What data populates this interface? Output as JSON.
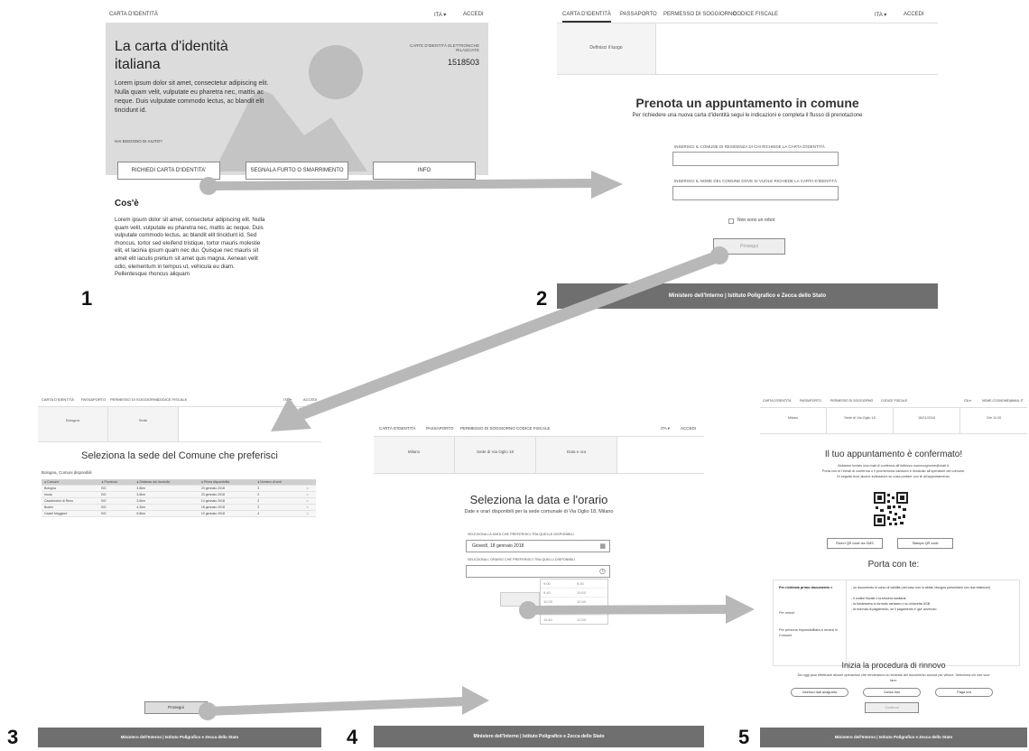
{
  "nav": {
    "carta": "CARTA D'IDENTITÀ",
    "passaporto": "PASSAPORTO",
    "permesso": "PERMESSO DI SOGGIORNO",
    "codice": "CODICE FISCALE",
    "lang": "ITA ▾",
    "accedi": "ACCEDI",
    "accedi_user": "NOME.COGNOME@MAIL.IT"
  },
  "footer_text": "Ministero dell'Interno | Istituto Poligrafico e Zecca dello Stato",
  "steps": {
    "s1": "1",
    "s2": "2",
    "s3": "3",
    "s4": "4",
    "s5": "5"
  },
  "screen1": {
    "title": "La carta d'identità italiana",
    "intro": "Lorem ipsum dolor sit amet, consectetur adipiscing elit. Nulla quam velit, vulputate eu pharetra nec, mattis ac neque. Duis vulputate commodo lectus, ac blandit elit tincidunt id.",
    "help": "HAI BISOGNO DI AIUTO?",
    "counter_label": "CARTE D'IDENTITÀ ELETTRONICHE RILASCIATE",
    "counter_value": "1518503",
    "btn_richiedi": "RICHIEDI CARTA D'IDENTITA'",
    "btn_segnala": "SEGNALA FURTO O SMARRIMENTO",
    "btn_info": "INFO",
    "section_title": "Cos'è",
    "section_body": "Lorem ipsum dolor sit amet, consectetur adipiscing elit. Nulla quam velit, vulputate eu pharetra nec, mattis ac neque. Duis vulputate commodo lectus, ac blandit elit tincidunt id. Sed rhoncus, tortor sed eleifend tristique, tortor mauris molestie elit, et lacinia ipsum quam nec dui. Quisque nec mauris sit amet elit iaculis pretium sit amet quis magna. Aenean velit odio, elementum in tempus ut, vehicula eu diam. Pellentesque rhoncus aliquam"
  },
  "screen2": {
    "tab": "Definisci il luogo",
    "title": "Prenota un appuntamento in comune",
    "subtitle": "Per richiedere una nuova carta d'identità segui le indicazioni e completa il flusso di prenotazione",
    "label1": "INSERISCI IL COMUNE DI RESIDENZA DI CHI RICHIEDE LA CARTA D'IDENTITÀ",
    "label2": "INSERISCI IL NOME DEL COMUNE DOVE SI VUOLE RICHIEDE LA CARTA D'IDENTITÀ",
    "captcha": "Non sono un robot",
    "btn": "Prosegui"
  },
  "screen3": {
    "tab1": "Bologna",
    "tab2": "Sede",
    "title": "Seleziona la sede del Comune che preferisci",
    "subtitle": "Bologna, Comuni disponibili",
    "headers": [
      "● Comune",
      "● Provincia",
      "● Distanza dal domicilio",
      "● Prima disponibilità",
      "● Numero di sedi"
    ],
    "rows": [
      [
        "Bologna",
        "BO",
        "3.6km",
        "23 gennaio 2018",
        "3"
      ],
      [
        "Imola",
        "BO",
        "3.6km",
        "23 gennaio 2018",
        "2"
      ],
      [
        "Casalecchio di Reno",
        "BO",
        "3.6km",
        "14 gennaio 2018",
        "2"
      ],
      [
        "Budrio",
        "BO",
        "4.2km",
        "18 gennaio 2018",
        "2"
      ],
      [
        "Castel Maggiore",
        "BO",
        "6.8km",
        "13 gennaio 2018",
        "4"
      ]
    ],
    "btn": "Prosegui"
  },
  "screen4": {
    "tab1": "Milano",
    "tab2": "Sede di Via Oglio 18",
    "tab3": "Data e ora",
    "title": "Seleziona la data e l'orario",
    "subtitle": "Date e orari disponibili per la sede comunale di Via Oglio 18, Milano",
    "label_date": "SELEZIONA LA DATA CHE PREFERISCI TRA QUELLE DISPONIBILI",
    "date_value": "Giovedì, 18 gennaio 2018",
    "label_time": "SELEZIONA L'ORARIO CHE PREFERISCI TRA QUELLI DISPONIBILI",
    "times": [
      "9:00",
      "9:20",
      "9:40",
      "10:00",
      "10:20",
      "10:40",
      "11:00",
      "11:20",
      "11:40",
      "12:00"
    ]
  },
  "screen5": {
    "tab1": "Milano",
    "tab2": "Sede di Via Oglio 18",
    "tab3": "18/01/2018",
    "tab4": "Ore 11:00",
    "title": "Il tuo appuntamento è confermato!",
    "desc1": "Abbiamo inviato una mail di conferma all'indirizzo nomecognome@mail.it.",
    "desc2": "Porta con te l'email di conferma o il promemoria cartaceo e mostralo all'operatore del comune.",
    "desc3": "Di seguito trovi alcune indicazioni su cosa portare con te all'appuntamento.",
    "btn_sms": "Ricevi QR code via SMS",
    "btn_print": "Stampa QR code",
    "porta_title": "Porta con te:",
    "menu1": "Per richiesta primo documento  >",
    "menu2": "Per minori",
    "menu3": "Per persona impossibilitata a recarsi in Comune",
    "list1": "- un documento in corso di validità (nel caso non si abbia, bisogna presentarsi con due testimoni)",
    "list2": "- il codice fiscale o la tessera sanitaria",
    "list3": "- la fototessera in formato cartaceo o su chiavetta USB",
    "list4": "- la ricevuta di pagamento, se il pagamento e' già' avvenuto",
    "renew_title": "Inizia la procedura di rinnovo",
    "renew_desc": "Da oggi puoi effettuare alcune operazioni che renderanno la richiesta del documento ancora più veloce. Seleziona ciò che vuoi fare:",
    "btn_ana": "Inserisci dati anagrafici",
    "btn_foto": "Carica foto",
    "btn_paga": "Paga ora",
    "btn_cont": "Continua"
  }
}
